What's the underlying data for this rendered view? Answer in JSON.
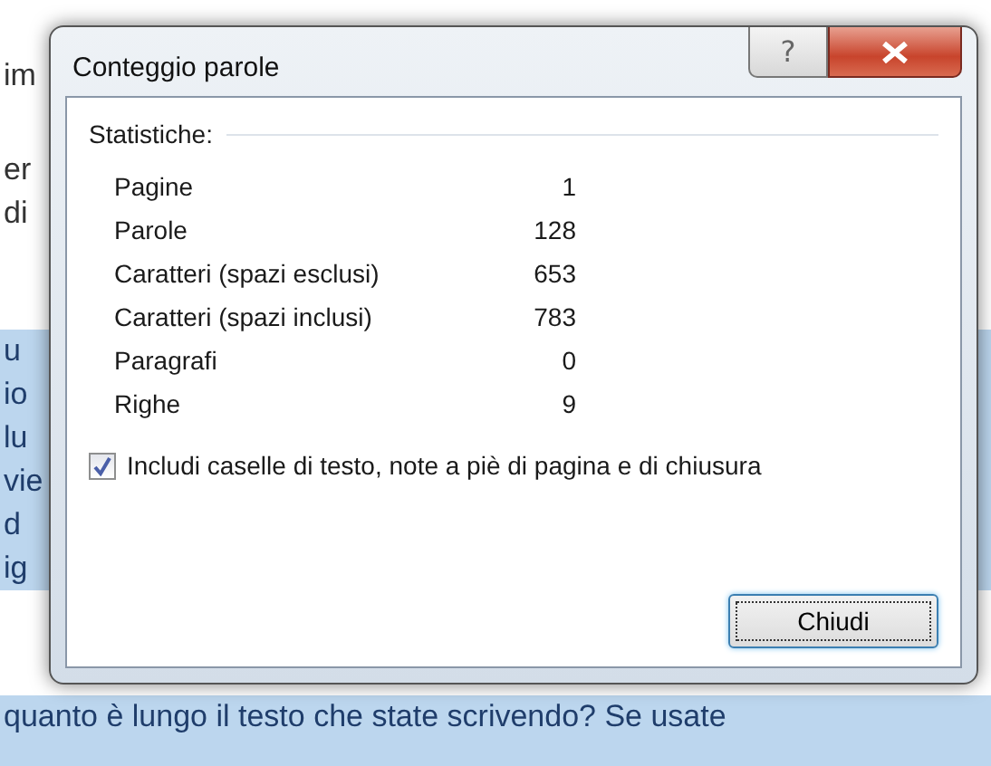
{
  "document": {
    "lines": [
      {
        "text": "im",
        "highlighted": false
      },
      {
        "text": "er",
        "highlighted": false
      },
      {
        "text": "di",
        "highlighted": false
      },
      {
        "text": "u",
        "highlighted": true
      },
      {
        "text": "io",
        "highlighted": true
      },
      {
        "text": "lu",
        "highlighted": true
      },
      {
        "text": "vie",
        "highlighted": true
      },
      {
        "text": "d",
        "highlighted": true
      },
      {
        "text": "ig",
        "highlighted": true
      }
    ],
    "bottom_line": {
      "text": "quanto è lungo il testo che state scrivendo? Se usate",
      "highlighted": true
    }
  },
  "dialog": {
    "title": "Conteggio parole",
    "help_button": "?",
    "section_title": "Statistiche:",
    "stats": [
      {
        "label": "Pagine",
        "value": "1"
      },
      {
        "label": "Parole",
        "value": "128"
      },
      {
        "label": "Caratteri (spazi esclusi)",
        "value": "653"
      },
      {
        "label": "Caratteri (spazi inclusi)",
        "value": "783"
      },
      {
        "label": "Paragrafi",
        "value": "0"
      },
      {
        "label": "Righe",
        "value": "9"
      }
    ],
    "checkbox": {
      "label": "Includi caselle di testo, note a piè di pagina e di chiusura",
      "checked": true
    },
    "close_button": "Chiudi"
  }
}
